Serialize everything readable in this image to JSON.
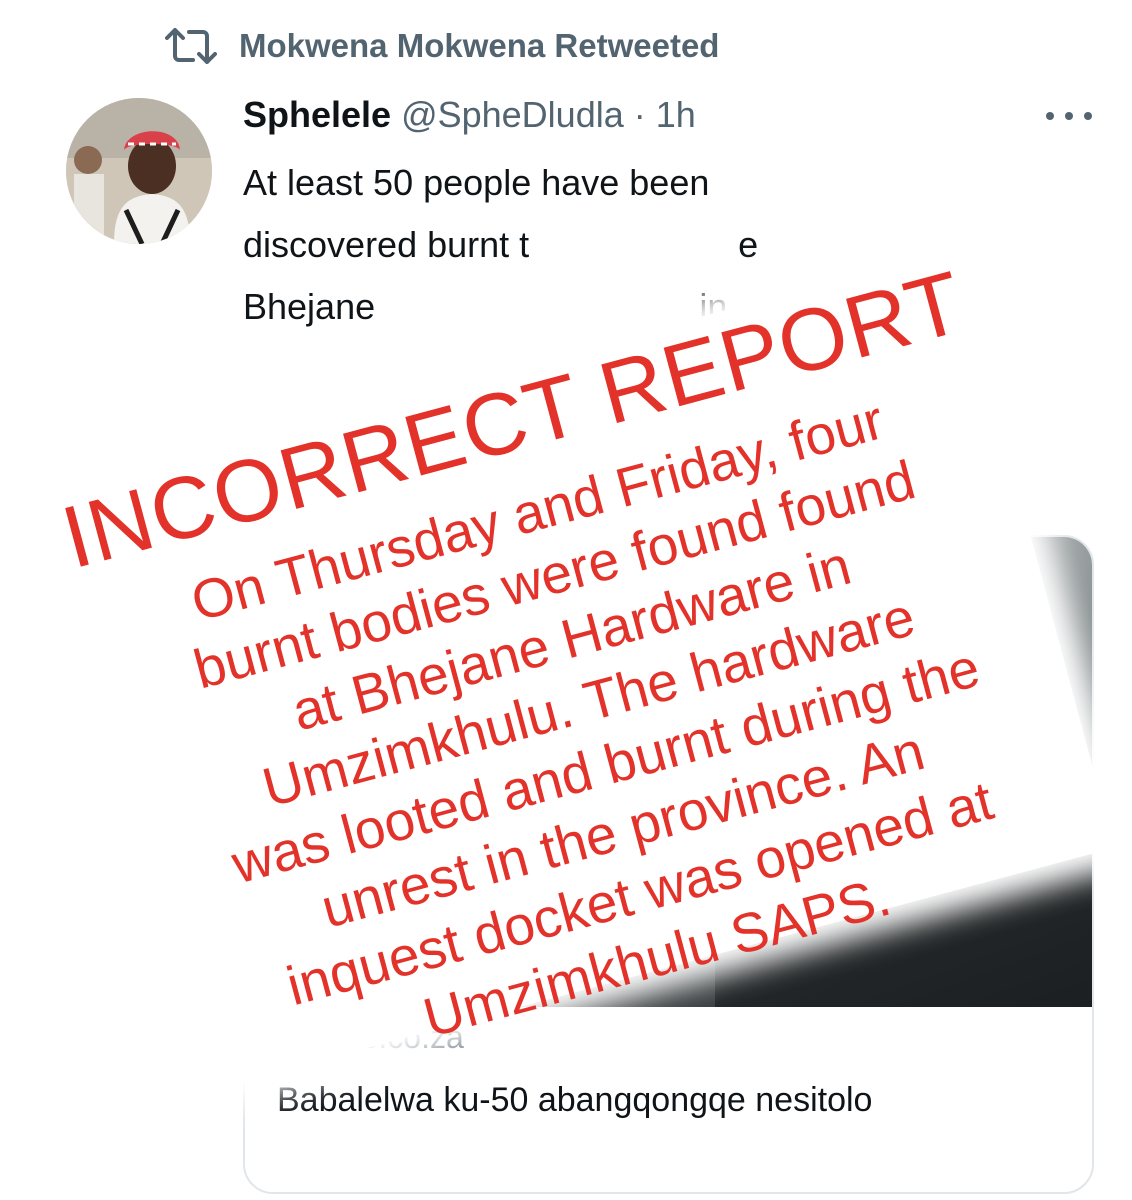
{
  "retweet": {
    "icon": "retweet-icon",
    "text": "Mokwena Mokwena Retweeted"
  },
  "tweet": {
    "avatar": "avatar",
    "display_name": "Sphelele",
    "handle_time": " @SpheDludla · 1h",
    "more_icon": "more-icon",
    "visible_text": "At least 50 people have been\ndiscovered burnt t                             e\nBhejane                                             in"
  },
  "card": {
    "domain": "...ezwe.co.za",
    "title": "Babalelwa ku-50 abangqongqe nesitolo"
  },
  "overlay": {
    "title": "INCORRECT REPORT",
    "lines": [
      "On Thursday and Friday, four",
      "burnt bodies were found found",
      "at Bhejane Hardware in",
      "Umzimkhulu. The hardware",
      "was looted and burnt during the",
      "unrest in the province. An",
      "inquest docket was opened at",
      "Umzimkhulu SAPS."
    ],
    "color": "#e2322a"
  }
}
